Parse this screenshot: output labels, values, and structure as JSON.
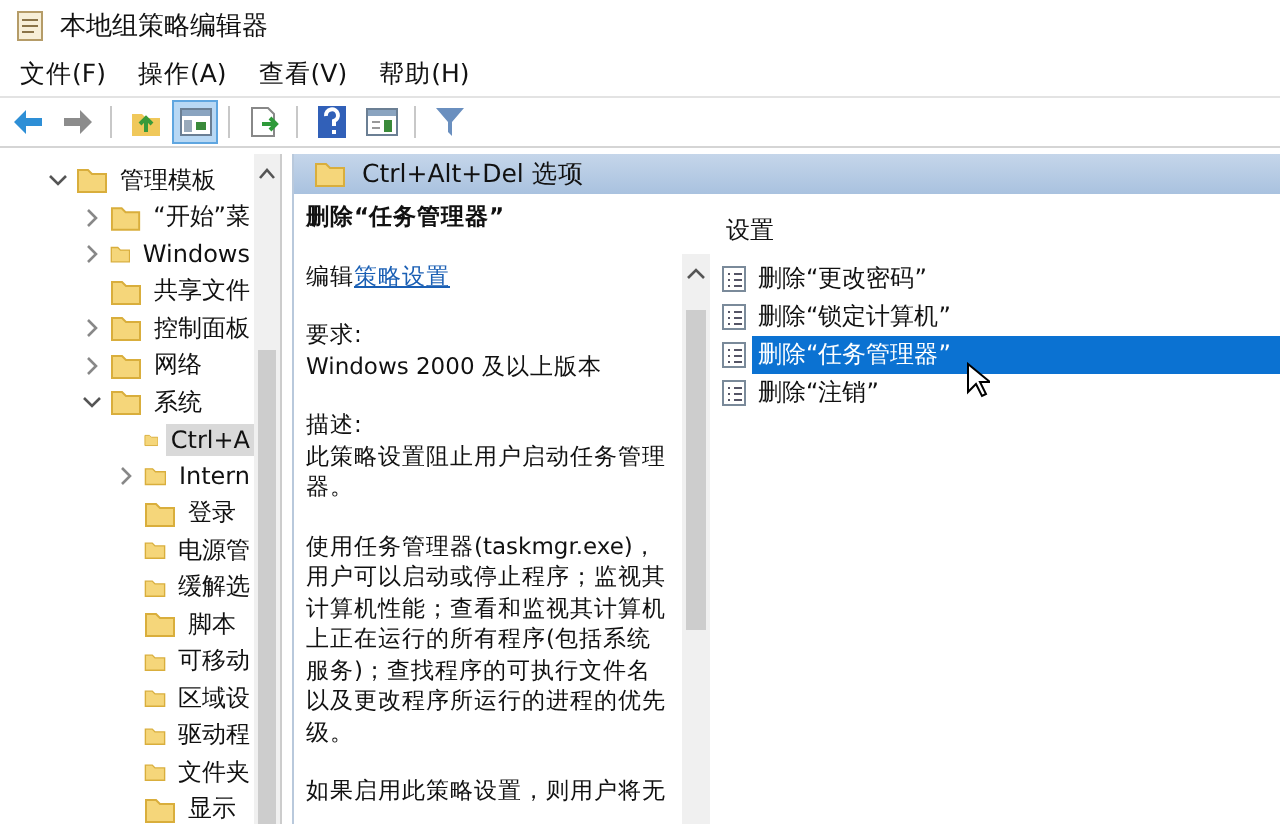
{
  "window": {
    "title": "本地组策略编辑器"
  },
  "menu": [
    {
      "label": "文件(F)"
    },
    {
      "label": "操作(A)"
    },
    {
      "label": "查看(V)"
    },
    {
      "label": "帮助(H)"
    }
  ],
  "toolbar": [
    {
      "buttons": [
        {
          "kind": "back",
          "pressed": false
        },
        {
          "kind": "forward",
          "pressed": false
        }
      ]
    },
    {
      "buttons": [
        {
          "kind": "up",
          "pressed": false
        },
        {
          "kind": "tree",
          "pressed": true
        }
      ]
    },
    {
      "buttons": [
        {
          "kind": "export",
          "pressed": false
        }
      ]
    },
    {
      "buttons": [
        {
          "kind": "help",
          "pressed": false
        },
        {
          "kind": "properties",
          "pressed": false
        }
      ]
    },
    {
      "buttons": [
        {
          "kind": "filter",
          "pressed": false
        }
      ]
    }
  ],
  "tree": {
    "items": [
      {
        "label": "管理模板",
        "kind": "expanded",
        "selected": false,
        "children": [
          {
            "label": "“开始”菜",
            "kind": "collapsed",
            "selected": false
          },
          {
            "label": "Windows",
            "kind": "collapsed",
            "selected": false
          },
          {
            "label": "共享文件",
            "kind": "leaf",
            "selected": false
          },
          {
            "label": "控制面板",
            "kind": "collapsed",
            "selected": false
          },
          {
            "label": "网络",
            "kind": "collapsed",
            "selected": false
          },
          {
            "label": "系统",
            "kind": "expanded",
            "selected": false,
            "children": [
              {
                "label": "Ctrl+A",
                "kind": "leaf",
                "selected": true
              },
              {
                "label": "Intern",
                "kind": "collapsed",
                "selected": false
              },
              {
                "label": "登录",
                "kind": "leaf",
                "selected": false
              },
              {
                "label": "电源管",
                "kind": "leaf",
                "selected": false
              },
              {
                "label": "缓解选",
                "kind": "leaf",
                "selected": false
              },
              {
                "label": "脚本",
                "kind": "leaf",
                "selected": false
              },
              {
                "label": "可移动",
                "kind": "leaf",
                "selected": false
              },
              {
                "label": "区域设",
                "kind": "leaf",
                "selected": false
              },
              {
                "label": "驱动程",
                "kind": "leaf",
                "selected": false
              },
              {
                "label": "文件夹",
                "kind": "leaf",
                "selected": false
              },
              {
                "label": "显示",
                "kind": "leaf",
                "selected": false
              }
            ]
          }
        ]
      }
    ]
  },
  "header": {
    "title": "Ctrl+Alt+Del 选项"
  },
  "description": {
    "title": "删除“任务管理器”",
    "edit_prefix": "编辑",
    "edit_link": "策略设置",
    "requirements_label": "要求:",
    "requirements": "Windows 2000 及以上版本",
    "description_label": "描述:",
    "paragraphs": [
      "此策略设置阻止用户启动任务管理器。",
      "使用任务管理器(taskmgr.exe)，用户可以启动或停止程序；监视其计算机性能；查看和监视其计算机上正在运行的所有程序(包括系统服务)；查找程序的可执行文件名以及更改程序所运行的进程的优先级。",
      "如果启用此策略设置，则用户将无"
    ]
  },
  "settings": {
    "column": "设置",
    "items": [
      {
        "label": "删除“更改密码”",
        "selected": false
      },
      {
        "label": "删除“锁定计算机”",
        "selected": false
      },
      {
        "label": "删除“任务管理器”",
        "selected": true
      },
      {
        "label": "删除“注销”",
        "selected": false
      }
    ]
  }
}
